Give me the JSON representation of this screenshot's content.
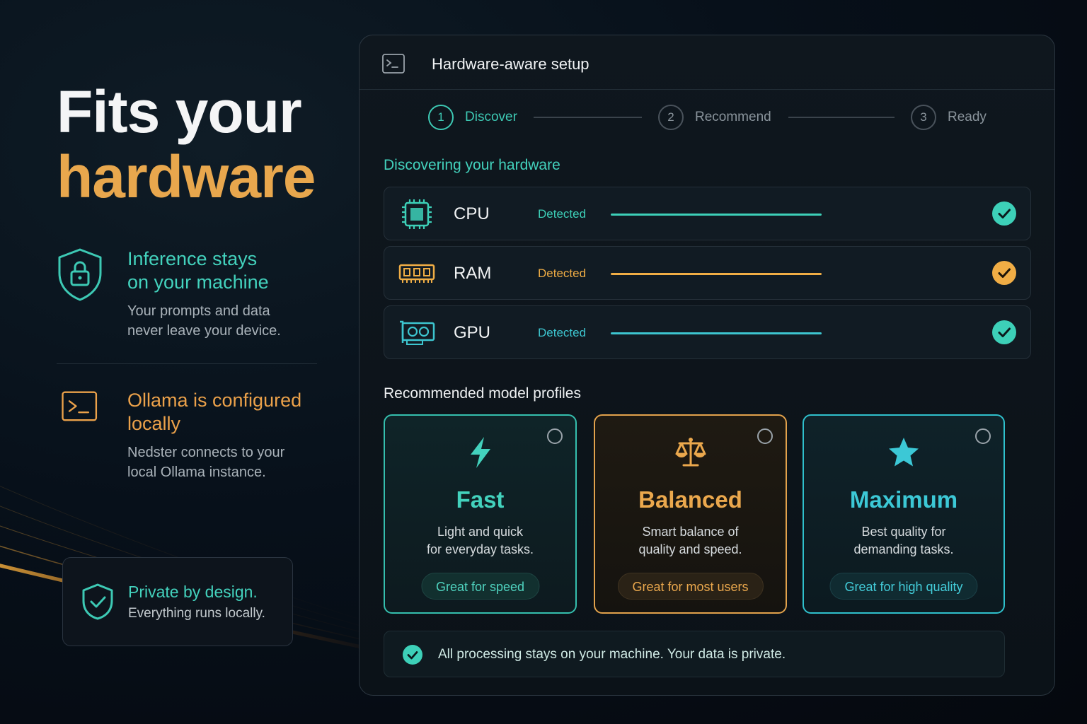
{
  "hero": {
    "line1": "Fits your",
    "line2": "hardware"
  },
  "features": [
    {
      "title": "Inference stays on your machine",
      "title_l1": "Inference stays",
      "title_l2": "on your machine",
      "desc_l1": "Your prompts and data",
      "desc_l2": "never leave your device.",
      "icon": "shield-lock-icon"
    },
    {
      "title_l1": "Ollama is configured",
      "title_l2": "locally",
      "desc_l1": "Nedster connects to your",
      "desc_l2": "local Ollama instance.",
      "icon": "terminal-icon"
    }
  ],
  "private_card": {
    "title": "Private by design.",
    "subtitle": "Everything runs locally.",
    "icon": "shield-check-icon"
  },
  "panel": {
    "title": "Hardware-aware setup",
    "steps": [
      {
        "number": "1",
        "label": "Discover",
        "active": true
      },
      {
        "number": "2",
        "label": "Recommend",
        "active": false
      },
      {
        "number": "3",
        "label": "Ready",
        "active": false
      }
    ],
    "discover_title": "Discovering your hardware",
    "hardware": [
      {
        "name": "CPU",
        "status": "Detected",
        "color": "#3dd0b8",
        "icon": "cpu-chip-icon",
        "progress": 1.0
      },
      {
        "name": "RAM",
        "status": "Detected",
        "color": "#f0ad45",
        "icon": "ram-module-icon",
        "progress": 1.0
      },
      {
        "name": "GPU",
        "status": "Detected",
        "color": "#3dc5cf",
        "icon": "gpu-card-icon",
        "progress": 1.0
      }
    ],
    "profiles_title": "Recommended model profiles",
    "profiles": [
      {
        "name": "Fast",
        "desc_l1": "Light and quick",
        "desc_l2": "for everyday tasks.",
        "tag": "Great for speed",
        "icon": "lightning-bolt-icon",
        "color": "#43d2bd"
      },
      {
        "name": "Balanced",
        "desc_l1": "Smart balance of",
        "desc_l2": "quality and speed.",
        "tag": "Great for most users",
        "icon": "scale-icon",
        "color": "#eba84d"
      },
      {
        "name": "Maximum",
        "desc_l1": "Best quality for",
        "desc_l2": "demanding tasks.",
        "tag": "Great for high quality",
        "icon": "star-icon",
        "color": "#3cc8d6"
      }
    ],
    "footer_note": "All processing stays on your machine. Your data is private."
  }
}
